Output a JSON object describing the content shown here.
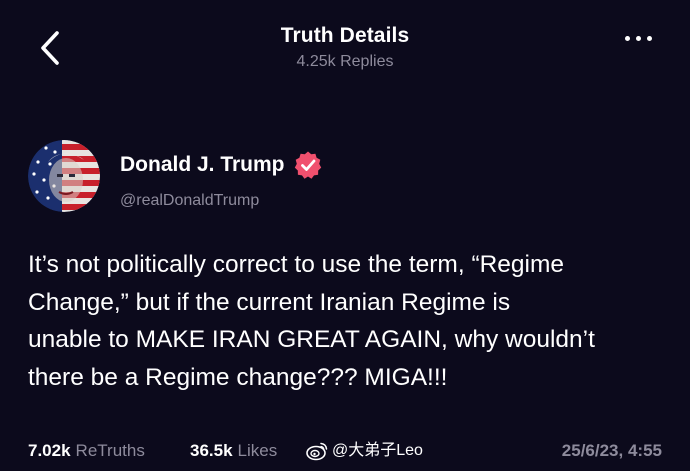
{
  "header": {
    "title": "Truth Details",
    "replies": "4.25k Replies"
  },
  "author": {
    "name": "Donald J. Trump",
    "handle": "@realDonaldTrump",
    "verified": true
  },
  "post": {
    "lines": [
      "It’s not politically correct to use the term, “Regime",
      "Change,” but if the current Iranian Regime is",
      "unable to MAKE IRAN GREAT AGAIN, why wouldn’t",
      "there be a Regime change??? MIGA!!!"
    ]
  },
  "stats": {
    "retruths_count": "7.02k",
    "retruths_label": "ReTruths",
    "likes_count": "36.5k",
    "likes_label": "Likes",
    "timestamp": "25/6/23, 4:55"
  },
  "watermark": {
    "text": "@大弟子Leo",
    "logo": "weibo-logo"
  },
  "colors": {
    "background": "#0c0a1c",
    "text_primary": "#ffffff",
    "text_secondary": "#8e8b9c",
    "verified_badge": "#f0506e"
  },
  "icons": {
    "back": "chevron-left-icon",
    "more": "more-horizontal-icon",
    "verified": "verified-badge-icon"
  }
}
